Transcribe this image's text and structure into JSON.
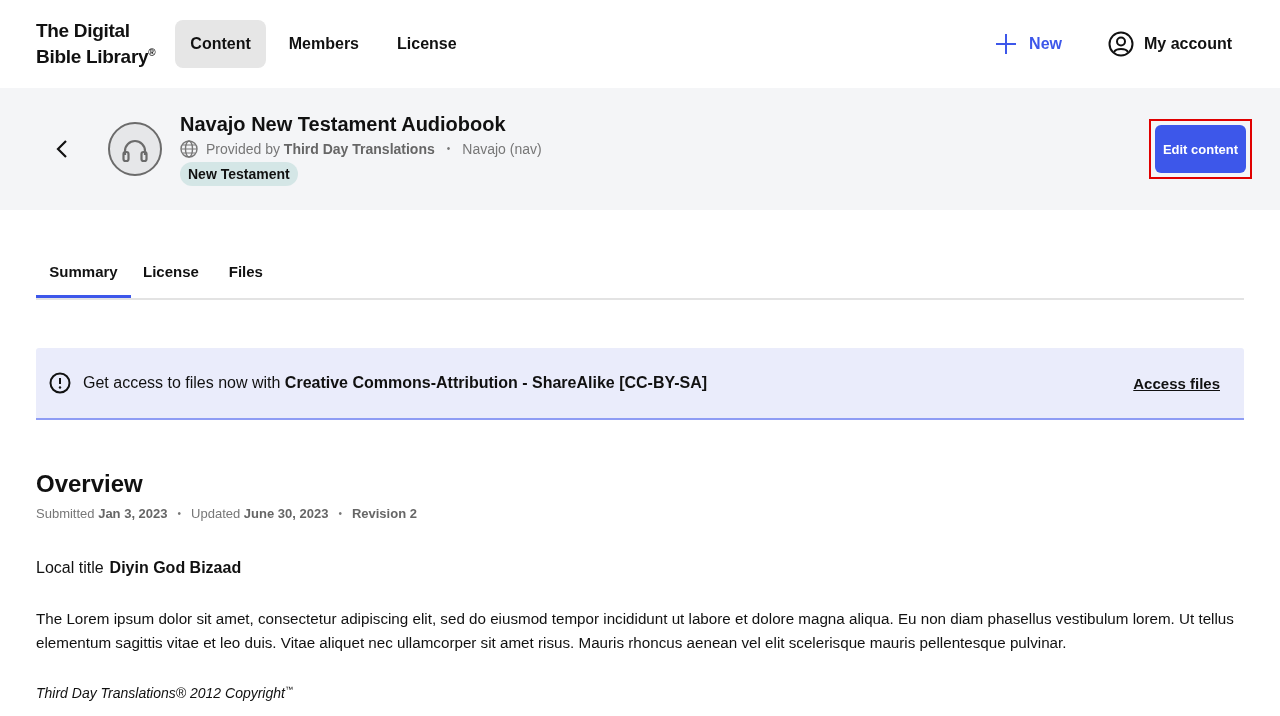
{
  "header": {
    "logo": [
      "The Digital",
      "Bible Library$^{®}$"
    ],
    "nav": [
      {
        "label": "Content",
        "selected": true
      },
      {
        "label": "Members",
        "selected": false
      },
      {
        "label": "License",
        "selected": false
      }
    ],
    "new_button": "New",
    "account": "My account"
  },
  "banner": {
    "title": "Navajo New Testament Audiobook",
    "provider": "Provided by **Third Day Translations**",
    "separator": "•",
    "language": "Navajo (nav)",
    "tag": "New Testament",
    "edit_button": {
      "label": "Edit content",
      "highlighted": true
    }
  },
  "tabs": [
    {
      "label": "Summary",
      "selected": true
    },
    {
      "label": "License",
      "selected": false
    },
    {
      "label": "Files",
      "selected": false
    }
  ],
  "alert": {
    "text": "Get access to files now with **Creative Commons-Attribution - ShareAlike [CC-BY-SA]**",
    "link": "Access files"
  },
  "overview": {
    "heading": "Overview",
    "meta": [
      "Submitted **Jan 3, 2023**",
      "•",
      "Updated **June 30, 2023**",
      "•",
      "**Revision 2**"
    ],
    "local_title_label": "Local title",
    "local_title": "Diyin God Bizaad",
    "description": "The Lorem ipsum dolor sit amet, consectetur adipiscing elit, sed do eiusmod tempor incididunt ut labore et dolore magna aliqua. Eu non diam phasellus vestibulum lorem. Ut tellus elementum sagittis vitae et leo duis. Vitae aliquet nec ullamcorper sit amet risus. Mauris rhoncus aenean vel elit scelerisque mauris pellentesque pulvinar.",
    "copyright": "Third Day Translations® 2012 Copyright$^{™}$"
  }
}
